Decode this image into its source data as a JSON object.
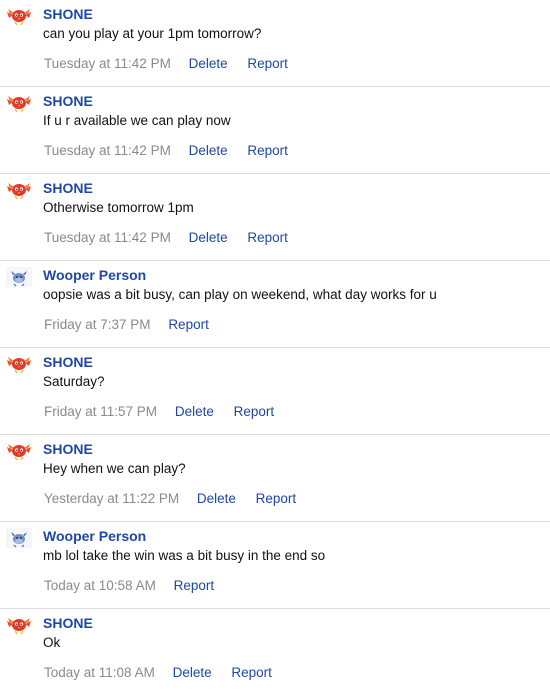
{
  "messages": [
    {
      "author": "SHONE",
      "avatar": "red-bird-icon",
      "text": "can you play at your 1pm tomorrow?",
      "time": "Tuesday at 11:42 PM",
      "actions": [
        "Delete",
        "Report"
      ]
    },
    {
      "author": "SHONE",
      "avatar": "red-bird-icon",
      "text": "If u r available we can play now",
      "time": "Tuesday at 11:42 PM",
      "actions": [
        "Delete",
        "Report"
      ]
    },
    {
      "author": "SHONE",
      "avatar": "red-bird-icon",
      "text": "Otherwise tomorrow 1pm",
      "time": "Tuesday at 11:42 PM",
      "actions": [
        "Delete",
        "Report"
      ]
    },
    {
      "author": "Wooper Person",
      "avatar": "blue-creature-icon",
      "text": "oopsie was a bit busy, can play on weekend, what day works for u",
      "time": "Friday at 7:37 PM",
      "actions": [
        "Report"
      ]
    },
    {
      "author": "SHONE",
      "avatar": "red-bird-icon",
      "text": "Saturday?",
      "time": "Friday at 11:57 PM",
      "actions": [
        "Delete",
        "Report"
      ]
    },
    {
      "author": "SHONE",
      "avatar": "red-bird-icon",
      "text": "Hey when we can play?",
      "time": "Yesterday at 11:22 PM",
      "actions": [
        "Delete",
        "Report"
      ]
    },
    {
      "author": "Wooper Person",
      "avatar": "blue-creature-icon",
      "text": "mb lol take the win was a bit busy in the end so",
      "time": "Today at 10:58 AM",
      "actions": [
        "Report"
      ]
    },
    {
      "author": "SHONE",
      "avatar": "red-bird-icon",
      "text": "Ok",
      "time": "Today at 11:08 AM",
      "actions": [
        "Delete",
        "Report"
      ]
    }
  ],
  "colors": {
    "author": "#1f47a6",
    "link": "#1f47a6",
    "timestamp": "#8a8a8a",
    "text": "#111111",
    "divider": "#dedede"
  }
}
